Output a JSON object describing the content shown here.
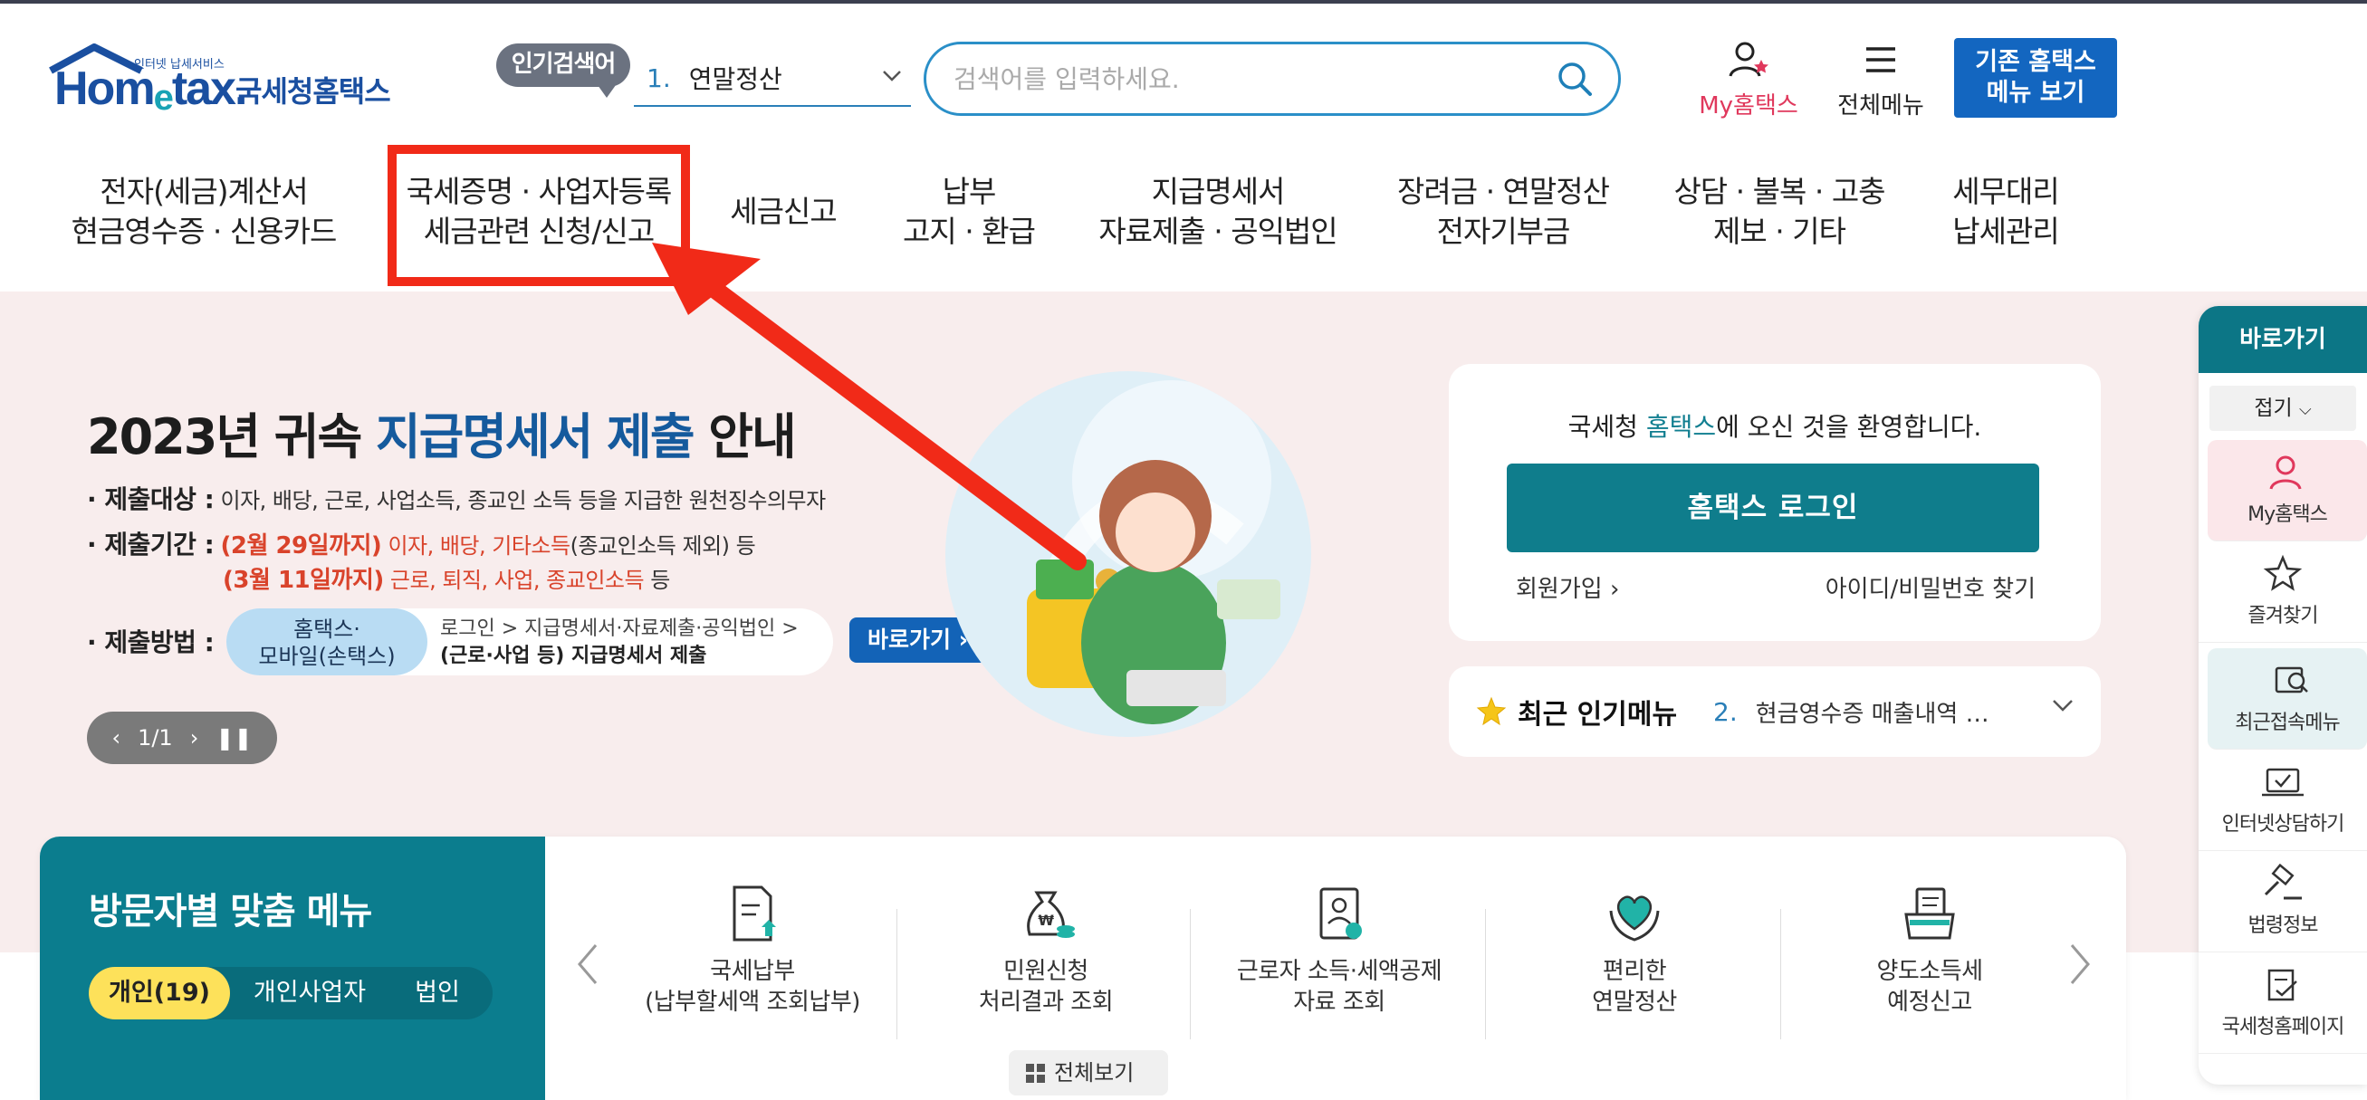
{
  "header": {
    "logo_word_prefix": "Hom",
    "logo_word_e": "e",
    "logo_word_suffix": "tax.",
    "logo_small": "인터넷 납세서비스",
    "logo_kr": "국세청홈택스",
    "popular_badge": "인기검색어",
    "popular_num": "1.",
    "popular_term": "연말정산",
    "search_placeholder": "검색어를 입력하세요.",
    "my_hometax": "My홈택스",
    "all_menu": "전체메뉴",
    "legacy_line1": "기존 홈택스",
    "legacy_line2": "메뉴 보기"
  },
  "gnb": [
    {
      "line1": "전자(세금)계산서",
      "line2": "현금영수증 · 신용카드"
    },
    {
      "line1": "국세증명 · 사업자등록",
      "line2": "세금관련 신청/신고"
    },
    {
      "line1": "세금신고",
      "line2": ""
    },
    {
      "line1": "납부",
      "line2": "고지 · 환급"
    },
    {
      "line1": "지급명세서",
      "line2": "자료제출 · 공익법인"
    },
    {
      "line1": "장려금 · 연말정산",
      "line2": "전자기부금"
    },
    {
      "line1": "상담 · 불복 · 고충",
      "line2": "제보 · 기타"
    },
    {
      "line1": "세무대리",
      "line2": "납세관리"
    }
  ],
  "banner": {
    "title_a": "2023년 귀속 ",
    "title_b": "지급명세서 제출",
    "title_c": " 안내",
    "target_label": "· 제출대상 :",
    "target_text": "이자, 배당, 근로, 사업소득, 종교인 소득 등을 지급한 원천징수의무자",
    "period_label": "· 제출기간 :",
    "period1_date": "(2월 29일까지)",
    "period1_text": "이자, 배당, 기타소득",
    "period1_note": "(종교인소득 제외) 등",
    "period2_date": "(3월 11일까지)",
    "period2_text": "근로, 퇴직, 사업, 종교인소득",
    "period2_note": " 등",
    "method_label": "· 제출방법 :",
    "method_pill_1": "홈택스·",
    "method_pill_2": "모바일(손택스)",
    "method_path_1": "로그인 > 지급명세서·자료제출·공익법인 >",
    "method_path_2": "(근로·사업 등) 지급명세서 제출",
    "go_button": "바로가기",
    "pager": "1/1"
  },
  "login": {
    "welcome_a": "국세청 ",
    "welcome_b": "홈택스",
    "welcome_c": "에 오신 것을 환영합니다.",
    "login_button": "홈택스 로그인",
    "join": "회원가입",
    "find": "아이디/비밀번호 찾기"
  },
  "recent_menu": {
    "title": "최근 인기메뉴",
    "num": "2.",
    "text": "현금영수증 매출내역 …"
  },
  "quickbar": {
    "title": "바로가기",
    "fold": "접기",
    "items": [
      "My홈택스",
      "즐겨찾기",
      "최근접속메뉴",
      "인터넷상담하기",
      "법령정보",
      "국세청홈페이지"
    ]
  },
  "custom_menu": {
    "title": "방문자별 맞춤 메뉴",
    "tabs": [
      "개인(19)",
      "개인사업자",
      "법인"
    ],
    "items": [
      {
        "line1": "국세납부",
        "line2": "(납부할세액 조회납부)"
      },
      {
        "line1": "민원신청",
        "line2": "처리결과 조회"
      },
      {
        "line1": "근로자 소득·세액공제",
        "line2": "자료 조회"
      },
      {
        "line1": "편리한",
        "line2": "연말정산"
      },
      {
        "line1": "양도소득세",
        "line2": "예정신고"
      }
    ],
    "view_all": "전체보기"
  },
  "colors": {
    "brand_teal": "#0f7d8c",
    "brand_blue": "#1366c0",
    "highlight_red": "#f12a18",
    "banner_bg": "#f8eded"
  }
}
